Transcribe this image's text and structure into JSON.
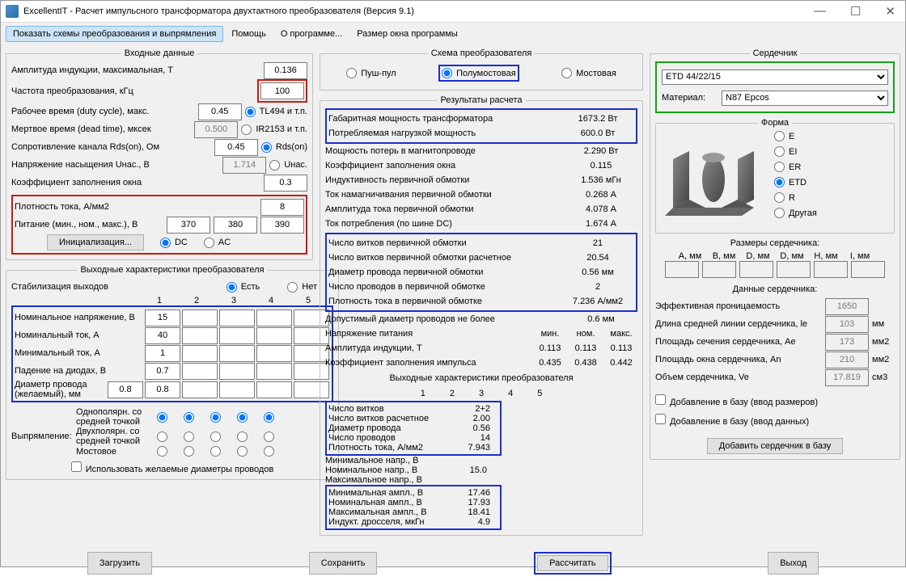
{
  "title": "ExcellentIT - Расчет импульсного трансформатора двухтактного преобразователя (Версия 9.1)",
  "menu": {
    "m1": "Показать схемы преобразования и выпрямления",
    "m2": "Помощь",
    "m3": "О программе...",
    "m4": "Размер окна программы"
  },
  "input": {
    "legend": "Входные данные",
    "r1": "Амплитуда индукции, максимальная, Т",
    "v1": "0.136",
    "r2": "Частота преобразования, кГц",
    "v2": "100",
    "r3": "Рабочее время (duty cycle), макс.",
    "v3": "0.45",
    "o3": "TL494 и т.п.",
    "r4": "Мертвое время (dead time), мксек",
    "v4": "0.500",
    "o4": "IR2153 и т.п.",
    "r5": "Сопротивление канала Rds(on), Ом",
    "v5": "0.45",
    "o5": "Rds(on)",
    "r6": "Напряжение насыщения Uнас., В",
    "v6": "1.714",
    "o6": "Uнас.",
    "r7": "Коэффициент заполнения окна",
    "v7": "0.3",
    "r8": "Плотность тока, А/мм2",
    "v8": "8",
    "r9": "Питание (мин., ном., макс.), В",
    "v9a": "370",
    "v9b": "380",
    "v9c": "390",
    "init": "Инициализация...",
    "dc": "DC",
    "ac": "AC"
  },
  "outchar": {
    "legend": "Выходные характеристики преобразователя",
    "stab": "Стабилизация выходов",
    "yes": "Есть",
    "no": "Нет",
    "r1": "Номинальное напряжение, В",
    "v1": "15",
    "r2": "Номинальный ток, А",
    "v2": "40",
    "r3": "Минимальный ток, А",
    "v3": "1",
    "r4": "Падение на диодах, В",
    "v4": "0.7",
    "r5": "Диаметр провода (желаемый), мм",
    "v5a": "0.8",
    "v5b": "0.8",
    "rect": "Выпрямление:",
    "rc1": "Однополярн. со средней точкой",
    "rc2": "Двухполярн. со средней точкой",
    "rc3": "Мостовое",
    "cb": "Использовать желаемые диаметры проводов"
  },
  "schema": {
    "legend": "Схема преобразователя",
    "s1": "Пуш-пул",
    "s2": "Полумостовая",
    "s3": "Мостовая"
  },
  "res": {
    "legend": "Результаты расчета",
    "r1": "Габаритная мощность трансформатора",
    "v1": "1673.2 Вт",
    "r2": "Потребляемая нагрузкой мощность",
    "v2": "600.0 Вт",
    "r3": "Мощность потерь в магнитопроводе",
    "v3": "2.290 Вт",
    "r4": "Коэффициент заполнения окна",
    "v4": "0.115",
    "r5": "Индуктивность первичной обмотки",
    "v5": "1.536 мГн",
    "r6": "Ток намагничивания первичной обмотки",
    "v6": "0.268 А",
    "r7": "Амплитуда тока первичной обмотки",
    "v7": "4.078 А",
    "r8": "Ток потребления (по шине DC)",
    "v8": "1.674 А",
    "r9": "Число витков первичной обмотки",
    "v9": "21",
    "r10": "Число витков первичной обмотки расчетное",
    "v10": "20.54",
    "r11": "Диаметр провода первичной обмотки",
    "v11": "0.56 мм",
    "r12": "Число проводов в первичной обмотке",
    "v12": "2",
    "r13": "Плотность тока в первичной обмотке",
    "v13": "7.236 А/мм2",
    "r14": "Допустимый диаметр проводов не более",
    "v14": "0.6 мм",
    "volt": "Напряжение питания",
    "min": "мин.",
    "nom": "ном.",
    "max": "макс.",
    "va": "0.113",
    "vb": "0.113",
    "vc": "0.113",
    "amp": "Амплитуда индукции, Т",
    "kf": "Коэффициент заполнения импульса",
    "ka": "0.435",
    "kb": "0.438",
    "kc": "0.442",
    "sub": "Выходные характеристики преобразователя",
    "w1": "Число витков",
    "wv1": "2+2",
    "w2": "Число витков расчетное",
    "wv2": "2.00",
    "w3": "Диаметр провода",
    "wv3": "0.56",
    "w4": "Число проводов",
    "wv4": "14",
    "w5": "Плотность тока, А/мм2",
    "wv5": "7.943",
    "x1": "Минимальное напр., В",
    "x2": "Номинальное напр., В",
    "xv2": "15.0",
    "x3": "Максимальное напр., В",
    "y1": "Минимальная ампл., В",
    "yv1": "17.46",
    "y2": "Номинальная ампл., В",
    "yv2": "17.93",
    "y3": "Максимальная ампл., В",
    "yv3": "18.41",
    "y4": "Индукт. дросселя, мкГн",
    "yv4": "4.9"
  },
  "core": {
    "legend": "Сердечник",
    "sel": "ETD 44/22/15",
    "mat": "Материал:",
    "matv": "N87 Epcos",
    "form": "Форма",
    "f1": "E",
    "f2": "EI",
    "f3": "ER",
    "f4": "ETD",
    "f5": "R",
    "f6": "Другая",
    "dims": "Размеры сердечника:",
    "a": "A, мм",
    "b": "B, мм",
    "d": "D, мм",
    "h": "H, мм",
    "l": "I, мм",
    "data": "Данные сердечника:",
    "d1": "Эффективная проницаемость",
    "dv1": "1650",
    "d2": "Длина средней линии сердечника, le",
    "dv2": "103",
    "du2": "мм",
    "d3": "Площадь сечения сердечника, Ae",
    "dv3": "173",
    "du3": "мм2",
    "d4": "Площадь окна сердечника, An",
    "dv4": "210",
    "du4": "мм2",
    "d5": "Объем сердечника, Ve",
    "dv5": "17.819",
    "du5": "см3",
    "cb1": "Добавление в базу (ввод размеров)",
    "cb2": "Добавление в базу (ввод данных)",
    "btn": "Добавить сердечник в базу"
  },
  "btns": {
    "b1": "Загрузить",
    "b2": "Сохранить",
    "b3": "Рассчитать",
    "b4": "Выход"
  }
}
